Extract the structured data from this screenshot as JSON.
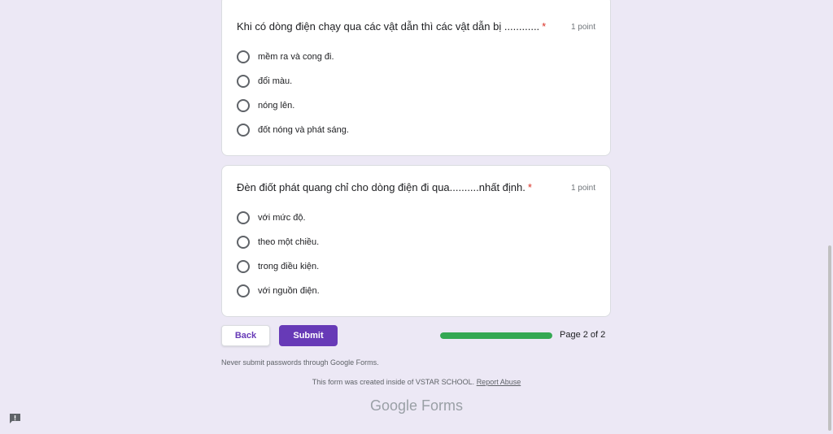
{
  "questions": [
    {
      "title": "Khi có dòng điện chạy qua các vật dẫn thì các vật dẫn bị ............",
      "required_mark": "*",
      "points": "1 point",
      "options": [
        "mềm ra và cong đi.",
        "đổi màu.",
        "nóng lên.",
        "đốt nóng và phát sáng."
      ]
    },
    {
      "title": "Đèn điốt phát quang chỉ cho dòng điện đi qua..........nhất định.",
      "required_mark": "*",
      "points": "1 point",
      "options": [
        "với mức độ.",
        "theo một chiều.",
        "trong điều kiện.",
        "với nguồn điện."
      ]
    }
  ],
  "nav": {
    "back_label": "Back",
    "submit_label": "Submit",
    "progress_fraction": 1.0,
    "page_text": "Page 2 of 2"
  },
  "footer": {
    "never_submit": "Never submit passwords through Google Forms.",
    "created_text": "This form was created inside of VSTAR SCHOOL.",
    "report_link": "Report Abuse",
    "logo_google": "Google",
    "logo_forms": "Forms"
  },
  "colors": {
    "accent": "#673ab7",
    "progress": "#34a853",
    "required": "#d93025",
    "background": "#ece8f5"
  },
  "icons": {
    "feedback": "feedback-icon"
  }
}
